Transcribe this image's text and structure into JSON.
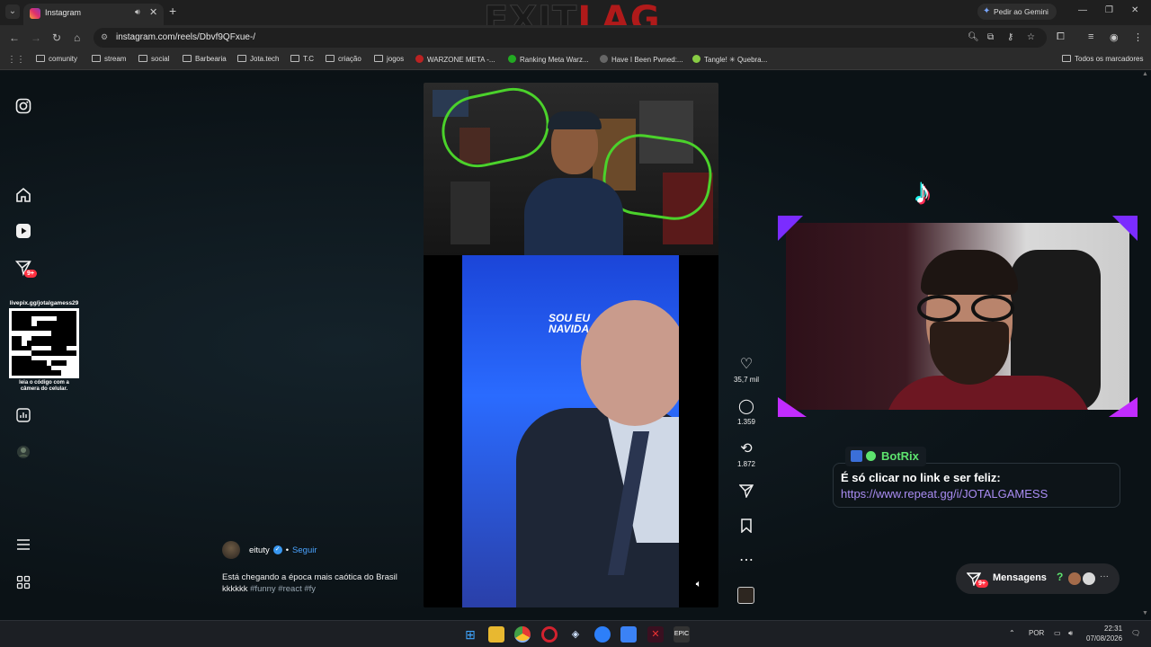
{
  "browser": {
    "tab_title": "Instagram",
    "url": "instagram.com/reels/Dbvf9QFxue-/",
    "gemini_label": "Pedir ao Gemini",
    "bookmarks": [
      "comunity",
      "stream",
      "social",
      "Barbearia",
      "Jota.tech",
      "T.C",
      "criação",
      "jogos",
      "WARZONE META -...",
      "Ranking Meta Warz...",
      "Have I Been Pwned:...",
      "Tangle! ✳ Quebra..."
    ],
    "all_bookmarks_label": "Todos os marcadores"
  },
  "brand_logo": {
    "part1": "EXIT",
    "part2": "LAG"
  },
  "sidebar": {
    "notifications_badge": "9+",
    "qr_url": "livepix.gg/jotalgamess29",
    "qr_caption_1": "leia o código com a",
    "qr_caption_2": "câmera do celular."
  },
  "post": {
    "username": "eituty",
    "separator": "•",
    "follow_label": "Seguir",
    "caption": "Está chegando a época mais caótica do Brasil kkkkkk",
    "hashtags": "#funny #react #fy",
    "stage_text_1": "SOU EU",
    "stage_text_2": "NAVIDA"
  },
  "actions": {
    "likes": "35,7 mil",
    "comments": "1.359",
    "reposts": "1.872"
  },
  "overlay": {
    "botrix_name": "BotRix",
    "botrix_line1": "É só clicar no link e ser feliz:",
    "botrix_line2": "https://www.repeat.gg/i/JOTALGAMESS"
  },
  "messages": {
    "label": "Mensagens",
    "badge": "9+",
    "help": "?",
    "more": "···"
  },
  "taskbar": {
    "language": "POR",
    "time": "22:31",
    "date": "07/08/2026"
  },
  "colors": {
    "accent_blue": "#4aa3ff",
    "badge_red": "#ff3040",
    "botrix_green": "#5de36e",
    "link_purple": "#a98cf2"
  }
}
